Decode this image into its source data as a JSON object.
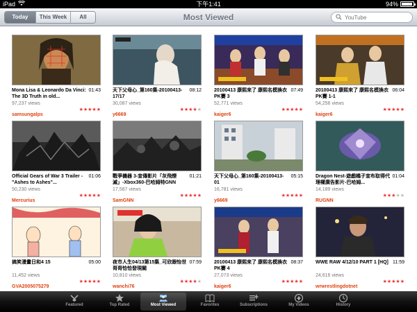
{
  "status_bar": {
    "device": "iPad",
    "time": "下午1:41",
    "battery": "94%",
    "battery_level": 0.94
  },
  "nav": {
    "filters": [
      "Today",
      "This Week",
      "All"
    ],
    "active_filter": "Today",
    "title": "Most Viewed",
    "search_placeholder": "YouTube"
  },
  "videos": [
    {
      "title": "Mona Lisa & Leonardo Da Vinci: The 3D Truth in old...",
      "duration": "01:43",
      "views": "97,237 views",
      "author": "samsungalps",
      "stars": "★★★★★",
      "stars_off": "",
      "thumb": "monalisa"
    },
    {
      "title": "天下父母心_第160集-20100413-17/17",
      "duration": "08:12",
      "views": "30,087 views",
      "author": "y6669",
      "stars": "★★★★",
      "stars_off": "★",
      "thumb": "tv1"
    },
    {
      "title": "20100413 康熙來了 康熙名模換衣PK賽 3",
      "duration": "07:49",
      "views": "52,771 views",
      "author": "kaiger6",
      "stars": "★★★★★",
      "stars_off": "",
      "thumb": "show1"
    },
    {
      "title": "20100413 康熙來了 康熙名模換衣PK賽 1-1",
      "duration": "06:04",
      "views": "54,256 views",
      "author": "kaiger6",
      "stars": "★★★★★",
      "stars_off": "",
      "thumb": "show2"
    },
    {
      "title": "Official Gears of War 3 Trailer - \"Ashes to Ashes\"...",
      "duration": "01:06",
      "views": "50,230 views",
      "author": "Mercurius",
      "stars": "★★★★★",
      "stars_off": "",
      "thumb": "gears1"
    },
    {
      "title": "戰爭機器 3-宣傳影片「灰飛煙滅」-Xbox360-巴哈姆特GNN",
      "duration": "01:21",
      "views": "17,587 views",
      "author": "SamGNN",
      "stars": "★★★★★",
      "stars_off": "",
      "thumb": "gears2"
    },
    {
      "title": "天下父母心_第160集-20100413-01",
      "duration": "05:15",
      "views": "16,781 views",
      "author": "y6669",
      "stars": "★★★★★",
      "stars_off": "",
      "thumb": "street"
    },
    {
      "title": "Dragon Nest-遊戲橘子宣布取得代理權廣告影片-巴哈姆...",
      "duration": "01:04",
      "views": "14,189 views",
      "author": "RUGNN",
      "stars": "★★★",
      "stars_off": "★★",
      "thumb": "dragon"
    },
    {
      "title": "搞笑漫畫日和4 15",
      "duration": "05:00",
      "views": "11,452 views",
      "author": "GVA2005075279",
      "stars": "★★★★★",
      "stars_off": "",
      "thumb": "cartoon"
    },
    {
      "title": "夜市人生04/13第15集_可欣跟怡世哥哥恰恰發現關",
      "duration": "07:59",
      "views": "10,810 views",
      "author": "wanchi76",
      "stars": "★★★★",
      "stars_off": "★",
      "thumb": "drama"
    },
    {
      "title": "20100413 康熙來了 康熙名模換衣PK賽 4",
      "duration": "08:37",
      "views": "27,073 views",
      "author": "kaiger6",
      "stars": "★★★★★",
      "stars_off": "",
      "thumb": "show3"
    },
    {
      "title": "WWE RAW 4/12/10 PART 1 [HQ]",
      "duration": "11:59",
      "views": "24,616 views",
      "author": "wrwrestlingdotnet",
      "stars": "★★★★★",
      "stars_off": "",
      "thumb": "wwe"
    }
  ],
  "tabs": [
    {
      "label": "Featured",
      "icon": "featured-icon",
      "active": false
    },
    {
      "label": "Top Rated",
      "icon": "star-icon",
      "active": false
    },
    {
      "label": "Most Viewed",
      "icon": "most-viewed-icon",
      "active": true
    },
    {
      "label": "Favorites",
      "icon": "book-icon",
      "active": false
    },
    {
      "label": "Subscriptions",
      "icon": "subscriptions-icon",
      "active": false
    },
    {
      "label": "My Videos",
      "icon": "my-videos-icon",
      "active": false
    },
    {
      "label": "History",
      "icon": "clock-icon",
      "active": false
    }
  ],
  "colors": {
    "author": "#e04010",
    "star_on": "#e33333",
    "star_off": "#bbbbbb",
    "tab_bar": "#111111",
    "nav_title": "#6e7883"
  }
}
